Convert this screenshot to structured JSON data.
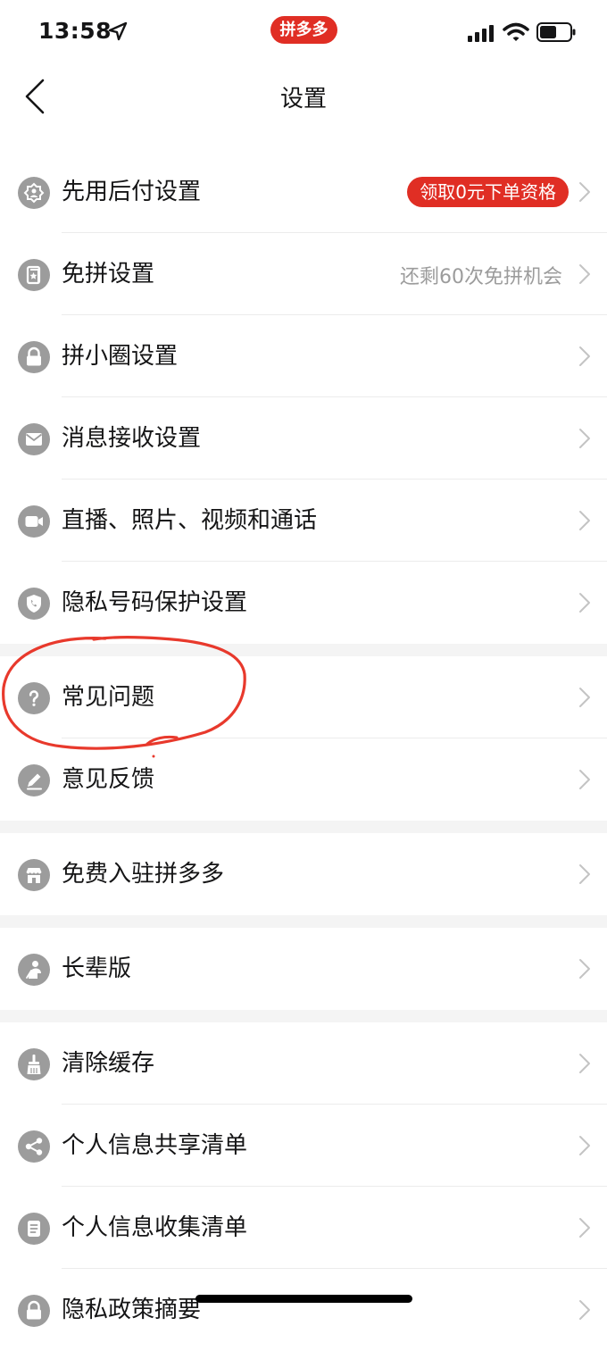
{
  "status_bar": {
    "time": "13:58",
    "app_badge": "拼多多"
  },
  "nav": {
    "title": "设置",
    "back_icon": "chevron-left-icon"
  },
  "sections": [
    {
      "items": [
        {
          "id": "paylater",
          "icon": "badge-icon",
          "label": "先用后付设置",
          "badge": "领取0元下单资格"
        },
        {
          "id": "free-group",
          "icon": "card-star-icon",
          "label": "免拼设置",
          "right_text": "还剩60次免拼机会"
        },
        {
          "id": "circle",
          "icon": "lock-icon",
          "label": "拼小圈设置"
        },
        {
          "id": "messages",
          "icon": "mail-icon",
          "label": "消息接收设置"
        },
        {
          "id": "live",
          "icon": "video-camera-icon",
          "label": "直播、照片、视频和通话"
        },
        {
          "id": "privacy-number",
          "icon": "shield-phone-icon",
          "label": "隐私号码保护设置"
        }
      ]
    },
    {
      "items": [
        {
          "id": "faq",
          "icon": "question-icon",
          "label": "常见问题"
        },
        {
          "id": "feedback",
          "icon": "pencil-icon",
          "label": "意见反馈"
        }
      ]
    },
    {
      "items": [
        {
          "id": "merchant",
          "icon": "store-icon",
          "label": "免费入驻拼多多"
        }
      ]
    },
    {
      "items": [
        {
          "id": "elder",
          "icon": "elder-person-icon",
          "label": "长辈版"
        }
      ]
    },
    {
      "items": [
        {
          "id": "cache",
          "icon": "broom-icon",
          "label": "清除缓存"
        },
        {
          "id": "share-list",
          "icon": "share-icon",
          "label": "个人信息共享清单"
        },
        {
          "id": "collect-list",
          "icon": "document-icon",
          "label": "个人信息收集清单"
        },
        {
          "id": "privacy-summary",
          "icon": "lock-icon",
          "label": "隐私政策摘要"
        }
      ]
    }
  ],
  "colors": {
    "accent": "#e02e24",
    "icon_gray": "#9c9c9c",
    "annotation": "#e8392c"
  }
}
